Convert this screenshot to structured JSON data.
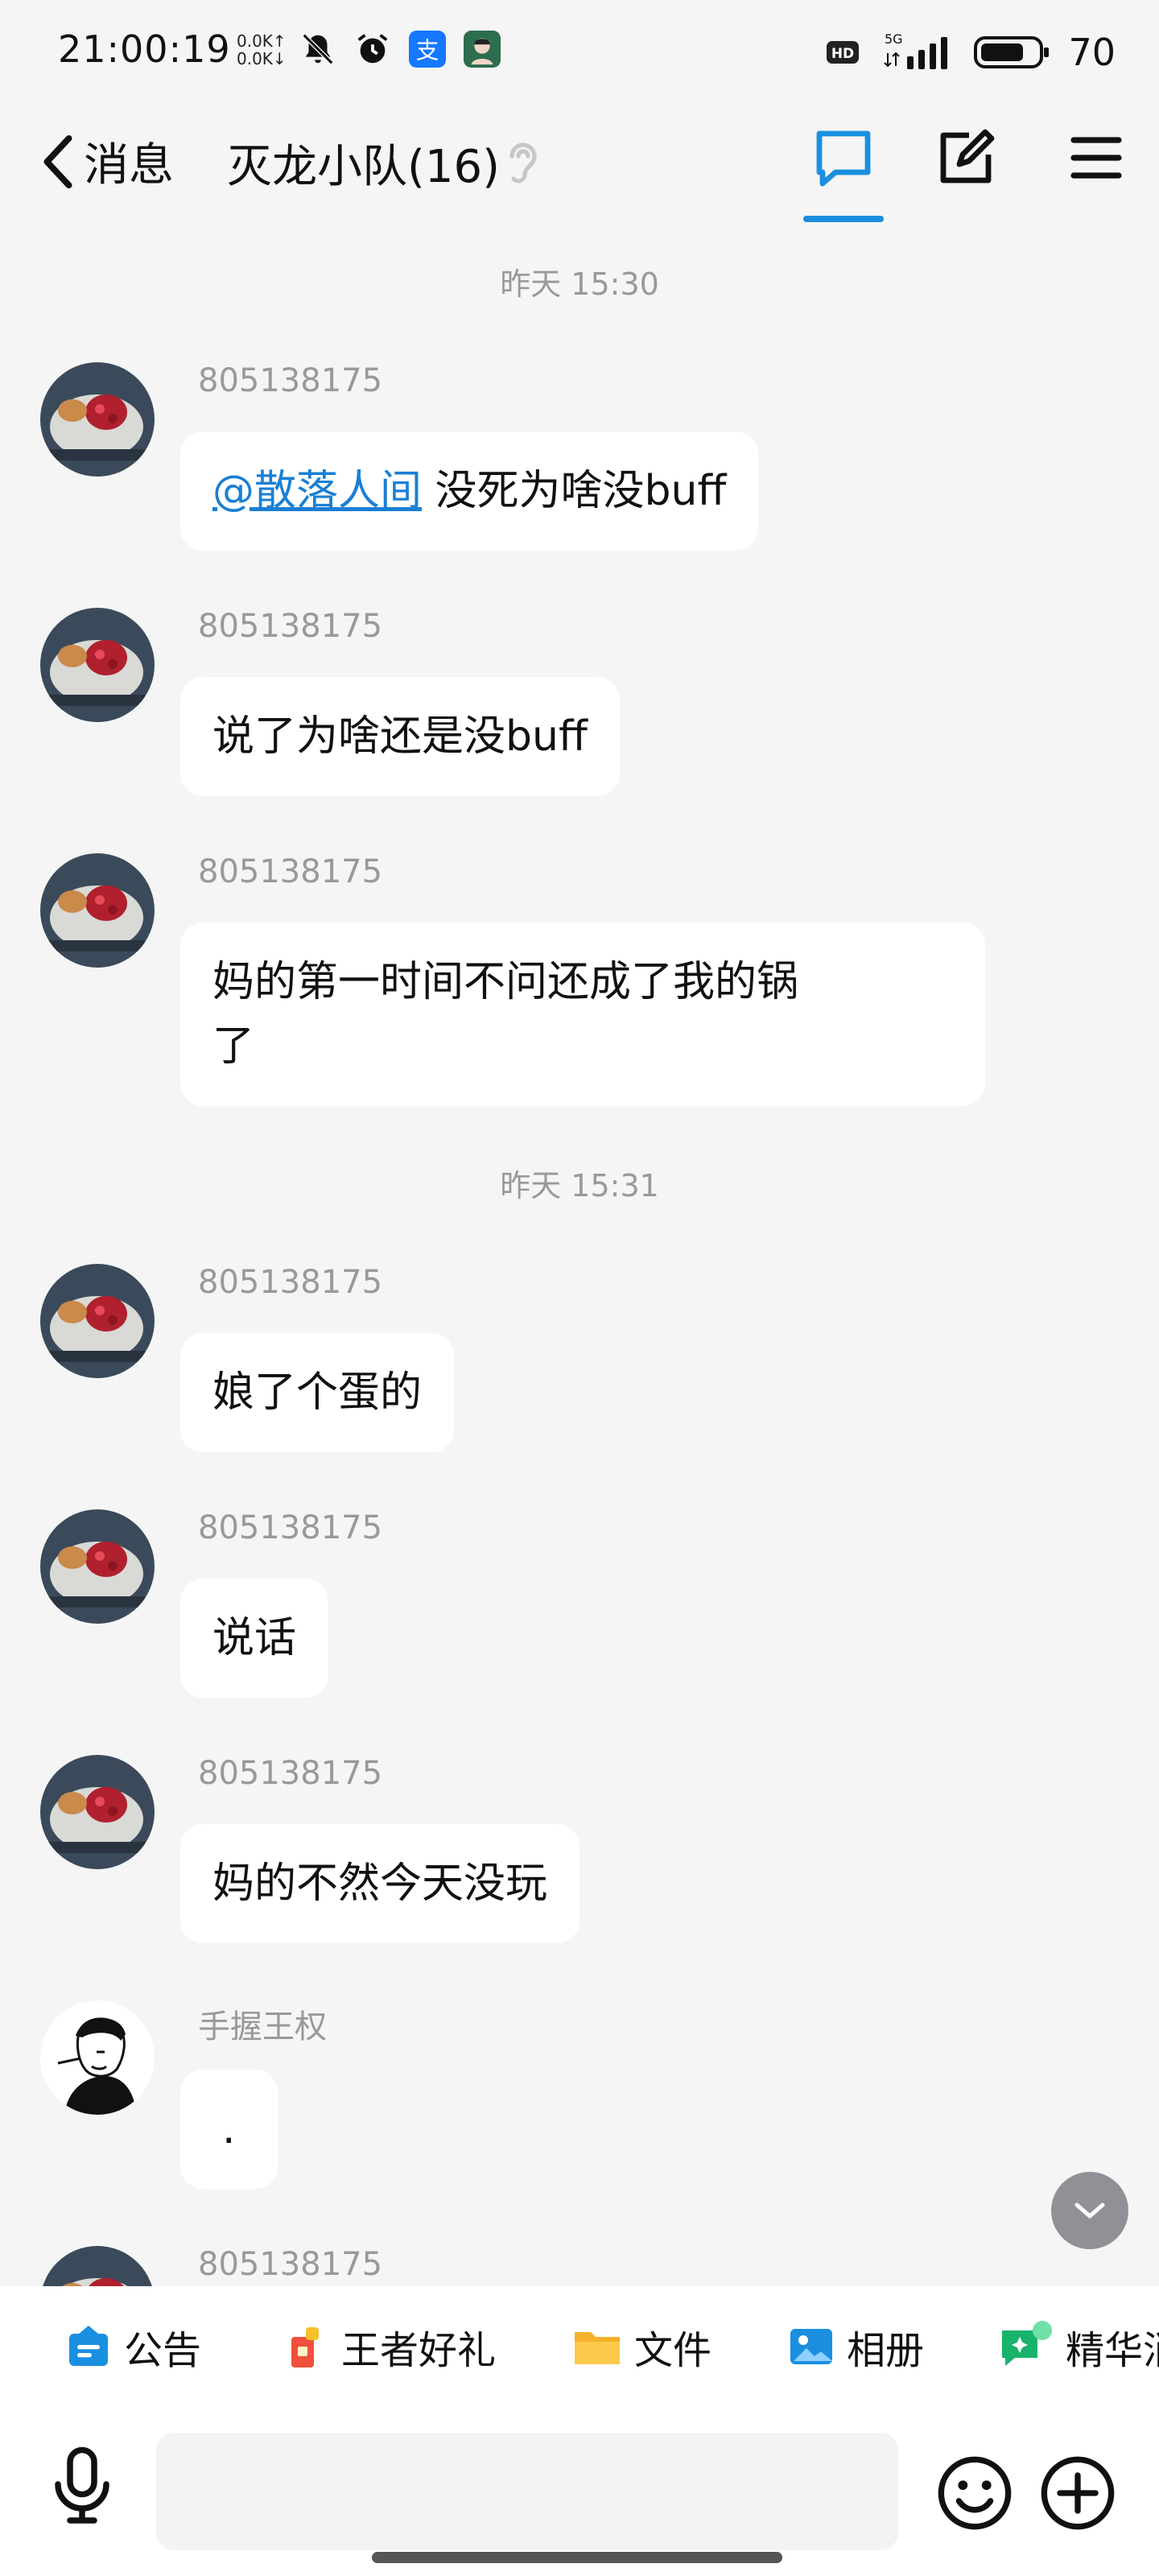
{
  "status_bar": {
    "time": "21:00:19",
    "net_up": "0.0K↑",
    "net_down": "0.0K↓",
    "hd": "HD",
    "signal": "5G",
    "battery": "70"
  },
  "header": {
    "back_label": "消息",
    "title": "灭龙小队(16)"
  },
  "timestamps": [
    "昨天 15:30",
    "昨天 15:31"
  ],
  "messages": [
    {
      "sender": "805138175",
      "mention": "@散落人间",
      "text": " 没死为啥没buff"
    },
    {
      "sender": "805138175",
      "text": "说了为啥还是没buff"
    },
    {
      "sender": "805138175",
      "text": "妈的第一时间不问还成了我的锅",
      "text2": "了"
    },
    {
      "sender": "805138175",
      "text": "娘了个蛋的"
    },
    {
      "sender": "805138175",
      "text": "说话"
    },
    {
      "sender": "805138175",
      "text": "妈的不然今天没玩"
    },
    {
      "sender": "手握王权",
      "text": "."
    },
    {
      "sender": "805138175"
    }
  ],
  "toolbar": {
    "items": [
      {
        "label": "公告",
        "color": "#1a8fe0"
      },
      {
        "label": "王者好礼",
        "color": "#f0503c"
      },
      {
        "label": "文件",
        "color": "#f6b12b"
      },
      {
        "label": "相册",
        "color": "#1a8fe0"
      },
      {
        "label": "精华消",
        "color": "#19b36b"
      }
    ]
  },
  "colors": {
    "accent": "#1a8fe0",
    "background": "#f5f5f5",
    "bubble": "#ffffff"
  }
}
